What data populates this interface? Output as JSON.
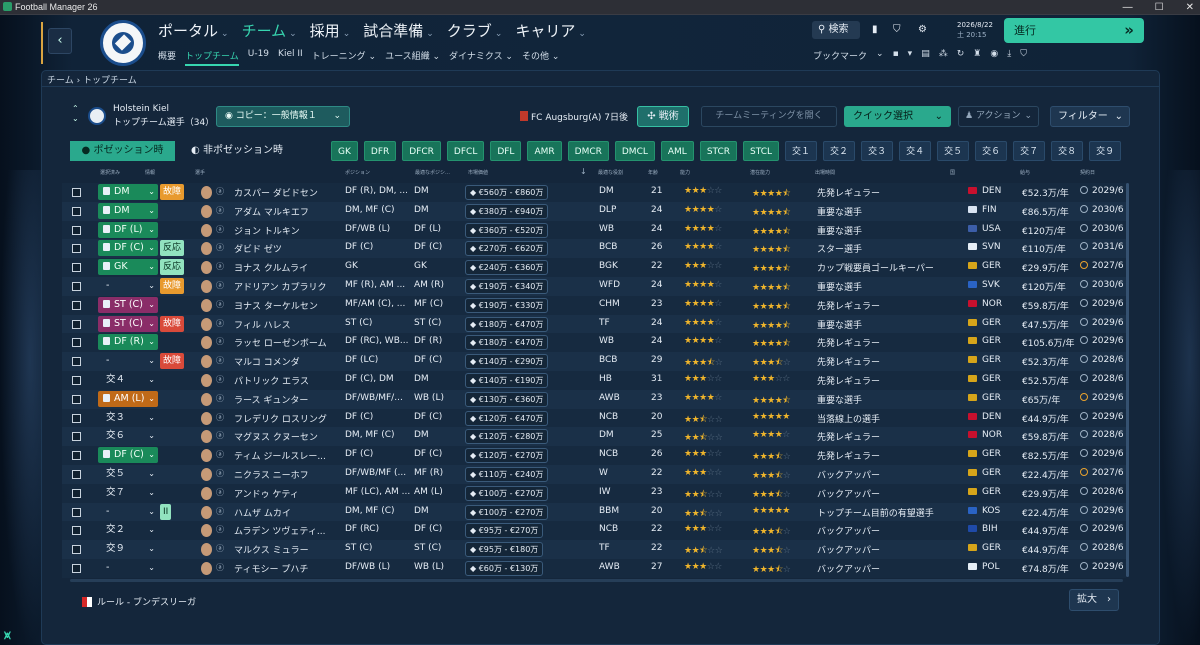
{
  "window": {
    "title": "Football Manager 26"
  },
  "nav": {
    "main": [
      "ポータル",
      "チーム",
      "採用",
      "試合準備",
      "クラブ",
      "キャリア"
    ],
    "sub": [
      "概要",
      "トップチーム",
      "U-19",
      "Kiel II",
      "トレーニング ⌄",
      "ユース組織 ⌄",
      "ダイナミクス ⌄",
      "その他 ⌄"
    ],
    "search": "検索",
    "date": "2026/8/22",
    "time": "土  20:15",
    "proceed": "進行",
    "bookmark": "ブックマーク"
  },
  "breadcrumb": "チーム › トップチーム",
  "club": {
    "name": "Holstein Kiel",
    "squad": "トップチーム選手（34）"
  },
  "toolbar": {
    "copy": "コピー：一般情報１",
    "next_match": "FC Augsburg(A) 7日後",
    "tactics": "戦術",
    "meeting": "チームミーティングを開く",
    "quick_select": "クイック選択",
    "action": "アクション",
    "filter": "フィルター"
  },
  "tabs": {
    "in_possession": "ポゼッション時",
    "out_possession": "非ポゼッション時"
  },
  "positions": [
    "GK",
    "DFR",
    "DFCR",
    "DFCL",
    "DFL",
    "AMR",
    "DMCR",
    "DMCL",
    "AML",
    "STCR",
    "STCL"
  ],
  "substitutes": [
    "交１",
    "交２",
    "交３",
    "交４",
    "交５",
    "交６",
    "交７",
    "交８",
    "交９"
  ],
  "columns": [
    "選択済み",
    "情報",
    "選手",
    "ポジション",
    "最適なポジシ…",
    "市場価値",
    "最適な役割",
    "年齢",
    "能力",
    "潜在能力",
    "出場時間",
    "国",
    "給与",
    "契約日"
  ],
  "players": [
    {
      "sel": "DM",
      "selcolor": "pos",
      "status": "故障",
      "stcls": "orn",
      "name": "カスパー ダビドセン",
      "pos": "DF (R), DM, ...",
      "best": "DM",
      "value": "€560万 - €860万",
      "role": "DM",
      "age": "21",
      "ca": 3,
      "pa": 4.5,
      "playing": "先発レギュラー",
      "nat": "DEN",
      "flag": "#c8102e",
      "wage": "€52.3万/年",
      "contract": "2029/6",
      "cw": false
    },
    {
      "sel": "DM",
      "selcolor": "pos",
      "status": "",
      "stcls": "",
      "name": "アダム マルキエフ",
      "pos": "DM, MF (C)",
      "best": "DM",
      "value": "€380万 - €940万",
      "role": "DLP",
      "age": "24",
      "ca": 4,
      "pa": 4.5,
      "playing": "重要な選手",
      "nat": "FIN",
      "flag": "#d9e4f2",
      "wage": "€86.5万/年",
      "contract": "2030/6",
      "cw": false
    },
    {
      "sel": "DF (L)",
      "selcolor": "pos",
      "status": "",
      "stcls": "",
      "name": "ジョン トルキン",
      "pos": "DF/WB (L)",
      "best": "DF (L)",
      "value": "€360万 - €520万",
      "role": "WB",
      "age": "24",
      "ca": 4,
      "pa": 4.5,
      "playing": "重要な選手",
      "nat": "USA",
      "flag": "#3c5ea8",
      "wage": "€120万/年",
      "contract": "2030/6",
      "cw": false
    },
    {
      "sel": "DF (C)",
      "selcolor": "pos",
      "status": "反応",
      "stcls": "react",
      "name": "ダビド ゼツ",
      "pos": "DF (C)",
      "best": "DF (C)",
      "value": "€270万 - €620万",
      "role": "BCB",
      "age": "26",
      "ca": 4,
      "pa": 4.5,
      "playing": "スター選手",
      "nat": "SVN",
      "flag": "#e6eef6",
      "wage": "€110万/年",
      "contract": "2031/6",
      "cw": false
    },
    {
      "sel": "GK",
      "selcolor": "pos",
      "status": "反応",
      "stcls": "react",
      "name": "ヨナス クルムライ",
      "pos": "GK",
      "best": "GK",
      "value": "€240万 - €360万",
      "role": "BGK",
      "age": "22",
      "ca": 3,
      "pa": 4.5,
      "playing": "カップ戦要員ゴールキーパー",
      "nat": "GER",
      "flag": "#d6a51a",
      "wage": "€29.9万/年",
      "contract": "2027/6",
      "cw": true
    },
    {
      "sel": "-",
      "selcolor": "txt",
      "status": "故障",
      "stcls": "orn",
      "name": "アドリアン カプラリク",
      "pos": "MF (R), AM ...",
      "best": "AM (R)",
      "value": "€190万 - €340万",
      "role": "WFD",
      "age": "24",
      "ca": 4,
      "pa": 4.5,
      "playing": "重要な選手",
      "nat": "SVK",
      "flag": "#2a63c4",
      "wage": "€120万/年",
      "contract": "2030/6",
      "cw": false
    },
    {
      "sel": "ST (C)",
      "selcolor": "mag",
      "status": "",
      "stcls": "",
      "name": "ヨナス ターケルセン",
      "pos": "MF/AM (C), ...",
      "best": "MF (C)",
      "value": "€190万 - €330万",
      "role": "CHM",
      "age": "23",
      "ca": 4,
      "pa": 4.5,
      "playing": "先発レギュラー",
      "nat": "NOR",
      "flag": "#c8102e",
      "wage": "€59.8万/年",
      "contract": "2029/6",
      "cw": false
    },
    {
      "sel": "ST (C)",
      "selcolor": "mag",
      "status": "故障",
      "stcls": "injury",
      "name": "フィル ハレス",
      "pos": "ST (C)",
      "best": "ST (C)",
      "value": "€180万 - €470万",
      "role": "TF",
      "age": "24",
      "ca": 4,
      "pa": 4.5,
      "playing": "重要な選手",
      "nat": "GER",
      "flag": "#d6a51a",
      "wage": "€47.5万/年",
      "contract": "2029/6",
      "cw": false
    },
    {
      "sel": "DF (R)",
      "selcolor": "pos",
      "status": "",
      "stcls": "",
      "name": "ラッセ ローゼンボーム",
      "pos": "DF (RC), WB...",
      "best": "DF (R)",
      "value": "€180万 - €470万",
      "role": "WB",
      "age": "24",
      "ca": 4,
      "pa": 4.5,
      "playing": "先発レギュラー",
      "nat": "GER",
      "flag": "#d6a51a",
      "wage": "€105.6万/年",
      "contract": "2029/6",
      "cw": false
    },
    {
      "sel": "-",
      "selcolor": "txt",
      "status": "故障",
      "stcls": "injury",
      "name": "マルコ コメンダ",
      "pos": "DF (LC)",
      "best": "DF (C)",
      "value": "€140万 - €290万",
      "role": "BCB",
      "age": "29",
      "ca": 3.5,
      "pa": 3.5,
      "playing": "先発レギュラー",
      "nat": "GER",
      "flag": "#d6a51a",
      "wage": "€52.3万/年",
      "contract": "2028/6",
      "cw": false
    },
    {
      "sel": "交４",
      "selcolor": "txt",
      "status": "",
      "stcls": "",
      "name": "パトリック エラス",
      "pos": "DF (C), DM",
      "best": "DM",
      "value": "€140万 - €190万",
      "role": "HB",
      "age": "31",
      "ca": 3,
      "pa": 3,
      "playing": "先発レギュラー",
      "nat": "GER",
      "flag": "#d6a51a",
      "wage": "€52.5万/年",
      "contract": "2028/6",
      "cw": false
    },
    {
      "sel": "AM (L)",
      "selcolor": "orn",
      "status": "",
      "stcls": "",
      "name": "ラース ギュンター",
      "pos": "DF/WB/MF/...",
      "best": "WB (L)",
      "value": "€130万 - €360万",
      "role": "AWB",
      "age": "23",
      "ca": 4,
      "pa": 4.5,
      "playing": "重要な選手",
      "nat": "GER",
      "flag": "#d6a51a",
      "wage": "€65万/年",
      "contract": "2029/6",
      "cw": true
    },
    {
      "sel": "交３",
      "selcolor": "txt",
      "status": "",
      "stcls": "",
      "name": "フレデリク ロスリング",
      "pos": "DF (C)",
      "best": "DF (C)",
      "value": "€120万 - €470万",
      "role": "NCB",
      "age": "20",
      "ca": 2.5,
      "pa": 5,
      "playing": "当落線上の選手",
      "nat": "DEN",
      "flag": "#c8102e",
      "wage": "€44.9万/年",
      "contract": "2029/6",
      "cw": false
    },
    {
      "sel": "交６",
      "selcolor": "txt",
      "status": "",
      "stcls": "",
      "name": "マグヌス クヌーセン",
      "pos": "DM, MF (C)",
      "best": "DM",
      "value": "€120万 - €280万",
      "role": "DM",
      "age": "25",
      "ca": 2.5,
      "pa": 4,
      "playing": "先発レギュラー",
      "nat": "NOR",
      "flag": "#c8102e",
      "wage": "€59.8万/年",
      "contract": "2028/6",
      "cw": false
    },
    {
      "sel": "DF (C)",
      "selcolor": "pos",
      "status": "",
      "stcls": "",
      "name": "ティム ジールスレー...",
      "pos": "DF (C)",
      "best": "DF (C)",
      "value": "€120万 - €270万",
      "role": "NCB",
      "age": "26",
      "ca": 3,
      "pa": 3.5,
      "playing": "先発レギュラー",
      "nat": "GER",
      "flag": "#d6a51a",
      "wage": "€82.5万/年",
      "contract": "2029/6",
      "cw": false
    },
    {
      "sel": "交５",
      "selcolor": "txt",
      "status": "",
      "stcls": "",
      "name": "ニクラス ニーホフ",
      "pos": "DF/WB/MF (...",
      "best": "MF (R)",
      "value": "€110万 - €240万",
      "role": "W",
      "age": "22",
      "ca": 3,
      "pa": 3.5,
      "playing": "バックアッパー",
      "nat": "GER",
      "flag": "#d6a51a",
      "wage": "€22.4万/年",
      "contract": "2027/6",
      "cw": true
    },
    {
      "sel": "交７",
      "selcolor": "txt",
      "status": "",
      "stcls": "",
      "name": "アンドゥ ケティ",
      "pos": "MF (LC), AM ...",
      "best": "AM (L)",
      "value": "€100万 - €270万",
      "role": "IW",
      "age": "23",
      "ca": 2.5,
      "pa": 3.5,
      "playing": "バックアッパー",
      "nat": "GER",
      "flag": "#d6a51a",
      "wage": "€29.9万/年",
      "contract": "2028/6",
      "cw": false
    },
    {
      "sel": "-",
      "selcolor": "txt",
      "status": "II",
      "stcls": "pause",
      "name": "ハムザ ムカイ",
      "pos": "DM, MF (C)",
      "best": "DM",
      "value": "€100万 - €270万",
      "role": "BBM",
      "age": "20",
      "ca": 2.5,
      "pa": 5,
      "playing": "トップチーム目前の有望選手",
      "nat": "KOS",
      "flag": "#2a63c4",
      "wage": "€22.4万/年",
      "contract": "2029/6",
      "cw": false
    },
    {
      "sel": "交２",
      "selcolor": "txt",
      "status": "",
      "stcls": "",
      "name": "ムラデン ツヴェティ...",
      "pos": "DF (RC)",
      "best": "DF (C)",
      "value": "€95万 - €270万",
      "role": "NCB",
      "age": "22",
      "ca": 3,
      "pa": 3.5,
      "playing": "バックアッパー",
      "nat": "BIH",
      "flag": "#1f4aa8",
      "wage": "€44.9万/年",
      "contract": "2029/6",
      "cw": false
    },
    {
      "sel": "交９",
      "selcolor": "txt",
      "status": "",
      "stcls": "",
      "name": "マルクス ミュラー",
      "pos": "ST (C)",
      "best": "ST (C)",
      "value": "€95万 - €180万",
      "role": "TF",
      "age": "22",
      "ca": 2.5,
      "pa": 3.5,
      "playing": "バックアッパー",
      "nat": "GER",
      "flag": "#d6a51a",
      "wage": "€44.9万/年",
      "contract": "2028/6",
      "cw": false
    },
    {
      "sel": "-",
      "selcolor": "txt",
      "status": "",
      "stcls": "",
      "name": "ティモシー プハチ",
      "pos": "DF/WB (L)",
      "best": "WB (L)",
      "value": "€60万 - €130万",
      "role": "AWB",
      "age": "27",
      "ca": 3,
      "pa": 3.5,
      "playing": "バックアッパー",
      "nat": "POL",
      "flag": "#e6eef6",
      "wage": "€74.8万/年",
      "contract": "2029/6",
      "cw": false
    }
  ],
  "footer": {
    "rules": "ルール - ブンデスリーガ",
    "expand": "拡大"
  }
}
